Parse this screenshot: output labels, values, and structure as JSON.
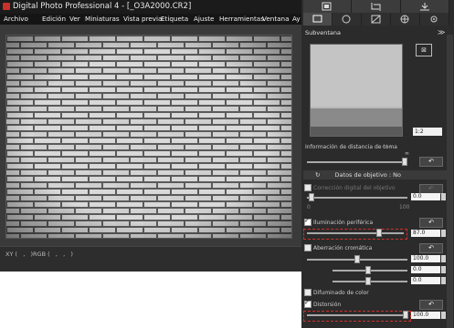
{
  "window": {
    "title": "Digital Photo Professional 4 - [_O3A2000.CR2]"
  },
  "menu": [
    "Archivo",
    "Edición",
    "Ver",
    "Miniaturas",
    "Vista previa",
    "Etiqueta",
    "Ajuste",
    "Herramientas",
    "Ventana",
    "Ay"
  ],
  "status": {
    "coords": "XY (   ,   )RGB (   ,   ,   )"
  },
  "panel": {
    "subventana": "Subventana",
    "zoom_value": "1:2",
    "distance_label": "Información de distancia de toma",
    "distance_hint": "‹ ! ›",
    "infinity": "∞",
    "lens_data_label": "Datos de objetivo : No",
    "lens_correction_label": "Corrección digital del objetivo",
    "lens_val": "0.0",
    "lens_min": "0",
    "lens_max": "100",
    "periph_label": "Iluminación periférica",
    "periph_val": "87.0",
    "chrom_label": "Aberración cromática",
    "chrom_val1": "100.0",
    "chrom_val2": "0.0",
    "chrom_val3": "0.0",
    "color_blur_label": "Difuminado de color",
    "distortion_label": "Distorsión",
    "distortion_val": "100.0",
    "accent": "#d0302a"
  }
}
